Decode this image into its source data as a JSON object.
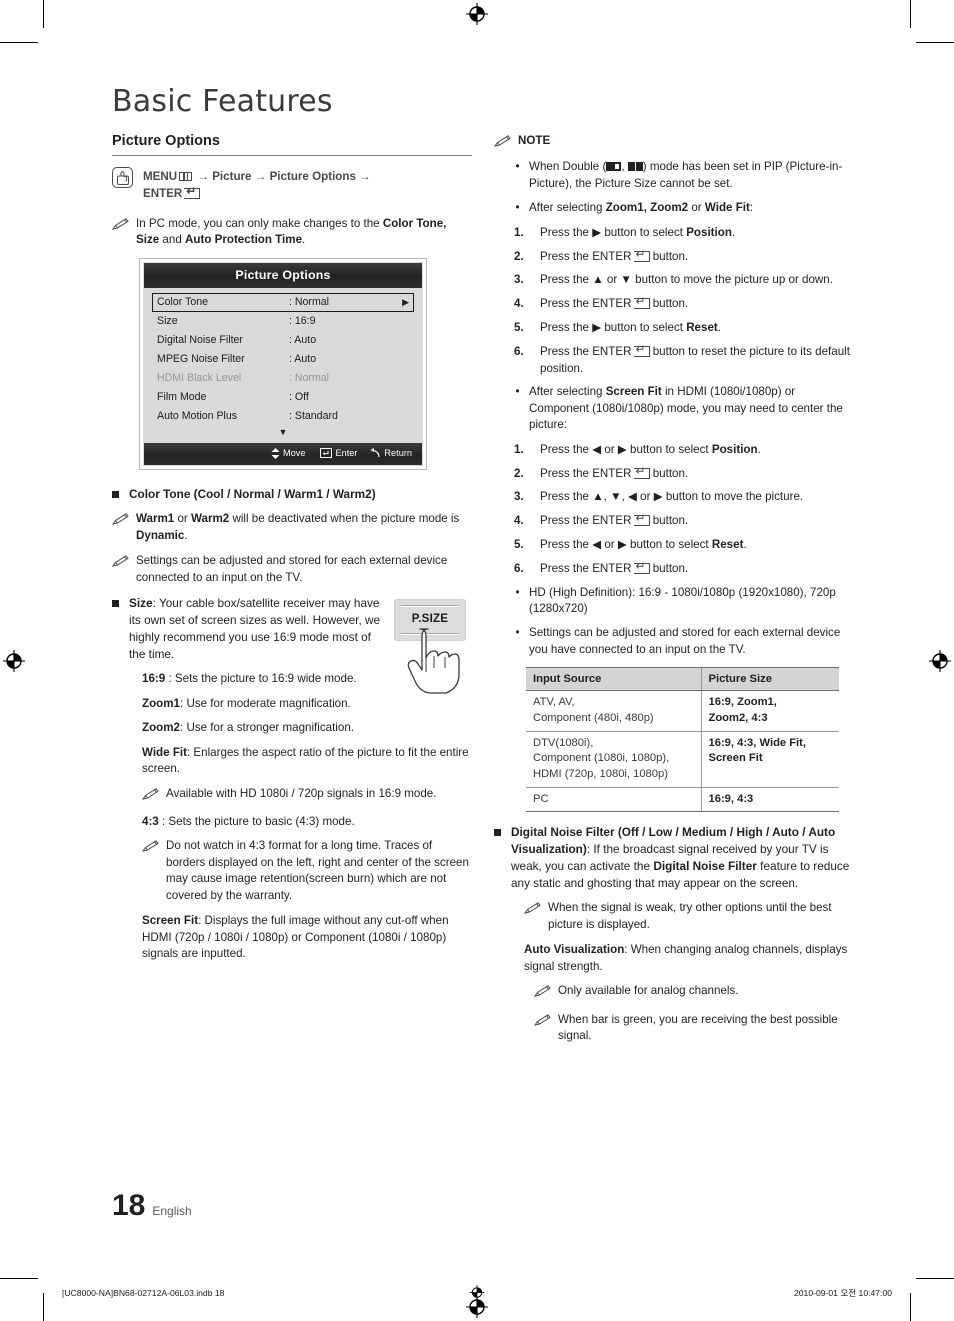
{
  "doc": {
    "title": "Basic Features",
    "section_title": "Picture Options",
    "page_number": "18",
    "language": "English"
  },
  "menu_path": {
    "menu_label": "MENU",
    "arrow": "→",
    "step2": "Picture",
    "step3": "Picture Options",
    "enter_label": "ENTER"
  },
  "left": {
    "pc_note_prefix": "In PC mode, you can only make changes to the ",
    "pc_note_bold1": "Color Tone, Size",
    "pc_note_mid": " and ",
    "pc_note_bold2": "Auto Protection Time",
    "pc_note_suffix": ".",
    "tv_menu": {
      "title": "Picture Options",
      "rows": [
        {
          "label": "Color Tone",
          "value": ": Normal",
          "selected": true,
          "disabled": false,
          "caret": "▶"
        },
        {
          "label": "Size",
          "value": ": 16:9",
          "selected": false,
          "disabled": false,
          "caret": ""
        },
        {
          "label": "Digital Noise Filter",
          "value": ": Auto",
          "selected": false,
          "disabled": false,
          "caret": ""
        },
        {
          "label": "MPEG Noise Filter",
          "value": ": Auto",
          "selected": false,
          "disabled": false,
          "caret": ""
        },
        {
          "label": "HDMI Black Level",
          "value": ": Normal",
          "selected": false,
          "disabled": true,
          "caret": ""
        },
        {
          "label": "Film Mode",
          "value": ": Off",
          "selected": false,
          "disabled": false,
          "caret": ""
        },
        {
          "label": "Auto Motion Plus",
          "value": ": Standard",
          "selected": false,
          "disabled": false,
          "caret": ""
        }
      ],
      "more_caret": "▼",
      "bar": {
        "move": "Move",
        "enter": "Enter",
        "return": "Return"
      }
    },
    "color_tone_heading": "Color Tone (Cool / Normal / Warm1 / Warm2)",
    "note_warm": {
      "b1": "Warm1",
      "t1": " or ",
      "b2": "Warm2",
      "t2": " will be deactivated when the picture mode is ",
      "b3": "Dynamic",
      "t3": "."
    },
    "note_settings": "Settings can be adjusted and stored for each external device connected to an input on the TV.",
    "size_heading_bold": "Size",
    "size_heading_rest": ": Your cable box/satellite receiver may have its own set of screen sizes as well. However, we highly recommend you use 16:9 mode most of the time.",
    "psize_key_label": "P.SIZE",
    "sizes": [
      {
        "bold": "16:9",
        "rest": " : Sets the picture to 16:9 wide mode."
      },
      {
        "bold": "Zoom1",
        "rest": ": Use for moderate magnification."
      },
      {
        "bold": "Zoom2",
        "rest": ": Use for a stronger magnification."
      },
      {
        "bold": "Wide Fit",
        "rest": ": Enlarges the aspect ratio of the picture to fit the entire screen."
      }
    ],
    "widefit_note": "Available with HD 1080i / 720p signals in 16:9 mode.",
    "ratio43_bold": "4:3",
    "ratio43_rest": " : Sets the picture to basic (4:3) mode.",
    "ratio43_note": "Do not watch in 4:3 format for a long time. Traces of borders displayed on the left, right and center of the screen may cause image retention(screen burn) which are not covered by the warranty.",
    "screenfit_bold": "Screen Fit",
    "screenfit_rest": ": Displays the full image without any cut-off when HDMI (720p / 1080i / 1080p) or Component (1080i / 1080p) signals are inputted."
  },
  "right": {
    "note_heading": "NOTE",
    "bullet_double": {
      "pre": "When Double (",
      "mid": ", ",
      "post": ") mode has been set in PIP (Picture-in-Picture), the Picture Size cannot be set."
    },
    "bullet_zoom": {
      "pre": "After selecting ",
      "bold": "Zoom1, Zoom2",
      "mid": " or ",
      "bold2": "Wide Fit",
      "post": ":"
    },
    "zoom_steps": [
      {
        "n": "1.",
        "pre": "Press the ▶ button to select ",
        "bold": "Position",
        "post": "."
      },
      {
        "n": "2.",
        "pre": "Press the ENTER",
        "bold": "",
        "post": " button.",
        "enter": true
      },
      {
        "n": "3.",
        "pre": "Press the ▲ or ▼ button to move the picture up or down.",
        "bold": "",
        "post": ""
      },
      {
        "n": "4.",
        "pre": "Press the ENTER",
        "bold": "",
        "post": " button.",
        "enter": true
      },
      {
        "n": "5.",
        "pre": "Press the ▶ button to select ",
        "bold": "Reset",
        "post": "."
      },
      {
        "n": "6.",
        "pre": "Press the ENTER",
        "bold": "",
        "post": " button to reset the picture to its default position.",
        "enter": true
      }
    ],
    "bullet_screenfit": {
      "pre": "After selecting ",
      "bold": "Screen Fit",
      "post": " in HDMI (1080i/1080p) or Component (1080i/1080p) mode, you may need to center the picture:"
    },
    "screenfit_steps": [
      {
        "n": "1.",
        "pre": "Press the ◀ or ▶ button to select ",
        "bold": "Position",
        "post": "."
      },
      {
        "n": "2.",
        "pre": "Press the ENTER",
        "bold": "",
        "post": " button.",
        "enter": true
      },
      {
        "n": "3.",
        "pre": "Press the ▲, ▼, ◀ or ▶ button to move the picture.",
        "bold": "",
        "post": ""
      },
      {
        "n": "4.",
        "pre": "Press the ENTER",
        "bold": "",
        "post": " button.",
        "enter": true
      },
      {
        "n": "5.",
        "pre": "Press the ◀ or ▶ button to select ",
        "bold": "Reset",
        "post": "."
      },
      {
        "n": "6.",
        "pre": "Press the ENTER",
        "bold": "",
        "post": " button.",
        "enter": true
      }
    ],
    "bullet_hd": "HD (High Definition): 16:9 - 1080i/1080p (1920x1080), 720p (1280x720)",
    "bullet_settings": "Settings can be adjusted and stored for each external device you have connected to an input on the TV.",
    "table": {
      "headers": [
        "Input Source",
        "Picture Size"
      ],
      "rows": [
        {
          "source": [
            "ATV, AV,",
            "Component (480i, 480p)"
          ],
          "size": [
            "16:9, Zoom1,",
            "Zoom2, 4:3"
          ]
        },
        {
          "source": [
            "DTV(1080i),",
            "Component (1080i, 1080p),",
            "HDMI (720p, 1080i, 1080p)"
          ],
          "size": [
            "16:9, 4:3, Wide Fit,",
            "Screen Fit"
          ]
        },
        {
          "source": [
            "PC"
          ],
          "size": [
            "16:9, 4:3"
          ]
        }
      ]
    },
    "dnf": {
      "b1": "Digital Noise Filter (Off / Low / Medium / High / Auto / Auto Visualization)",
      "t1": ": If the broadcast signal received by your TV is weak, you can activate the ",
      "b2": "Digital Noise Filter",
      "t2": " feature to reduce any static and ghosting that may appear on the screen."
    },
    "dnf_note": "When the signal is weak, try other options until the best picture is displayed.",
    "autoviz_bold": "Auto Visualization",
    "autoviz_rest": ": When changing analog channels, displays signal strength.",
    "autoviz_note1": "Only available for analog channels.",
    "autoviz_note2": "When bar is green, you are receiving the best possible signal."
  },
  "footer": {
    "left": "[UC8000-NA]BN68-02712A-06L03.indb   18",
    "right": "2010-09-01   오전 10:47:00"
  }
}
